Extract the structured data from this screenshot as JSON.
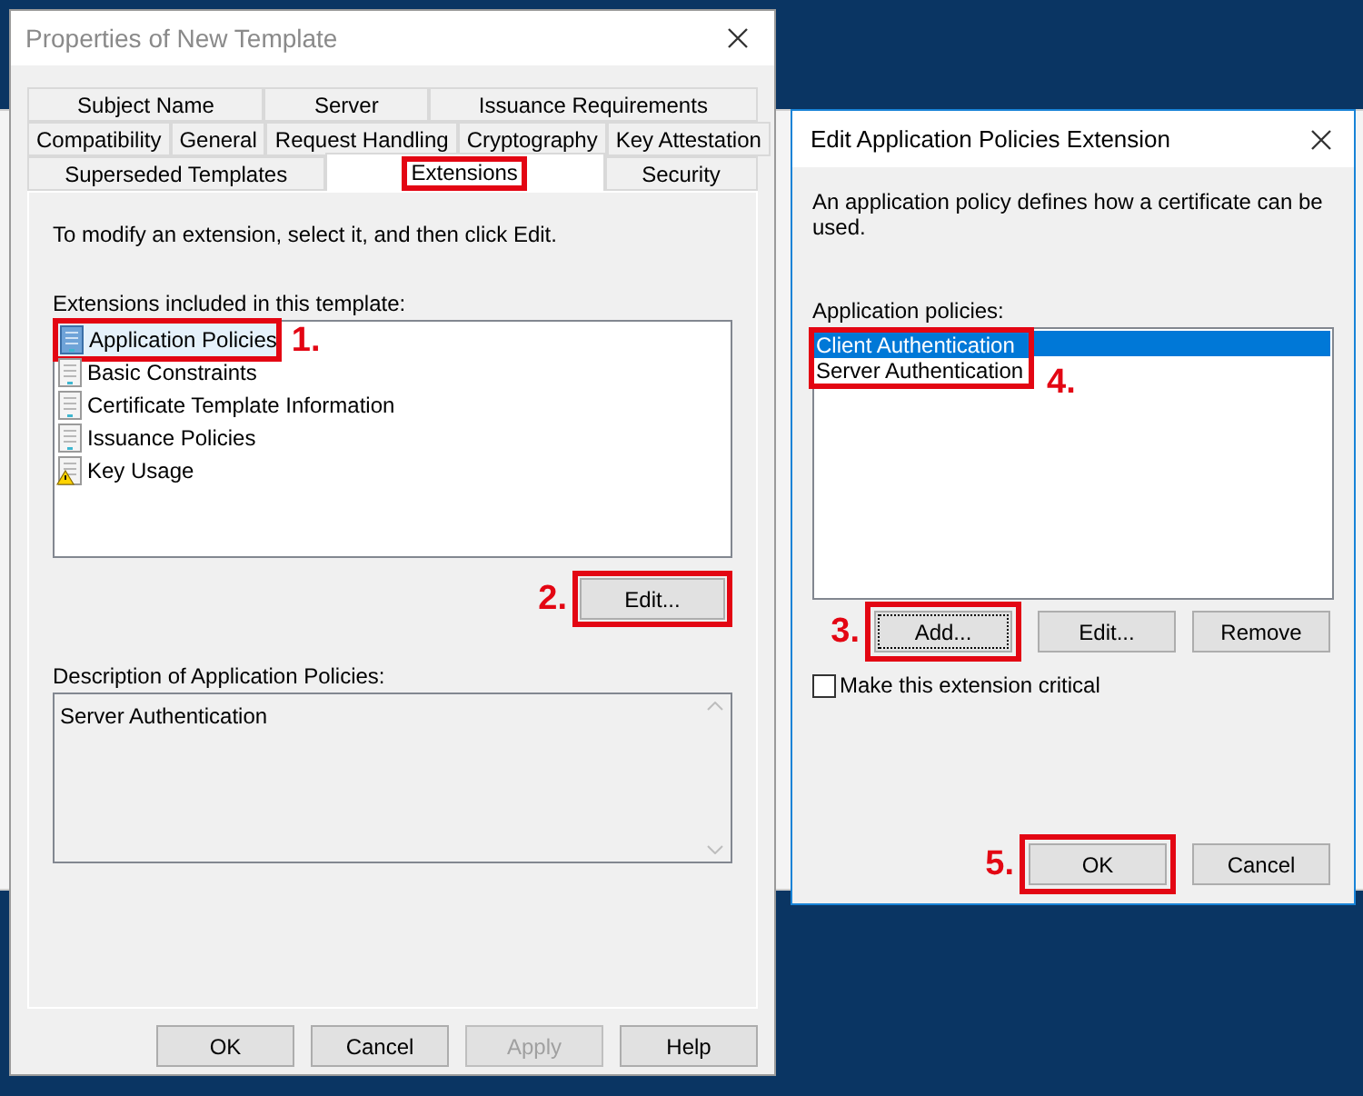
{
  "main_dialog": {
    "title": "Properties of New Template",
    "tab_rows": [
      [
        {
          "label": "Subject Name",
          "selected": false,
          "highlighted": false
        },
        {
          "label": "Server",
          "selected": false,
          "highlighted": false
        },
        {
          "label": "Issuance Requirements",
          "selected": false,
          "highlighted": false
        }
      ],
      [
        {
          "label": "Compatibility",
          "selected": false,
          "highlighted": false
        },
        {
          "label": "General",
          "selected": false,
          "highlighted": false
        },
        {
          "label": "Request Handling",
          "selected": false,
          "highlighted": false
        },
        {
          "label": "Cryptography",
          "selected": false,
          "highlighted": false
        },
        {
          "label": "Key Attestation",
          "selected": false,
          "highlighted": false
        }
      ],
      [
        {
          "label": "Superseded Templates",
          "selected": false,
          "highlighted": false
        },
        {
          "label": "Extensions",
          "selected": true,
          "highlighted": true
        },
        {
          "label": "Security",
          "selected": false,
          "highlighted": false
        }
      ]
    ],
    "instruction": "To modify an extension, select it, and then click Edit.",
    "extensions_label": "Extensions included in this template:",
    "extensions": [
      {
        "label": "Application Policies",
        "kind": "document",
        "selected": true,
        "step": "1."
      },
      {
        "label": "Basic Constraints",
        "kind": "document",
        "selected": false
      },
      {
        "label": "Certificate Template Information",
        "kind": "document",
        "selected": false
      },
      {
        "label": "Issuance Policies",
        "kind": "document",
        "selected": false
      },
      {
        "label": "Key Usage",
        "kind": "warning",
        "selected": false
      }
    ],
    "edit_button": {
      "label": "Edit...",
      "step": "2."
    },
    "description_label": "Description of Application Policies:",
    "description": "Server Authentication",
    "buttons": [
      {
        "label": "OK",
        "disabled": false
      },
      {
        "label": "Cancel",
        "disabled": false
      },
      {
        "label": "Apply",
        "disabled": true
      },
      {
        "label": "Help",
        "disabled": false
      }
    ]
  },
  "edit_dialog": {
    "title": "Edit Application Policies Extension",
    "description": "An application policy defines how a certificate can be used.",
    "policies_label": "Application policies:",
    "policies": [
      {
        "label": "Client Authentication",
        "selected": true
      },
      {
        "label": "Server Authentication",
        "selected": false
      }
    ],
    "policies_step": "4.",
    "list_buttons": [
      {
        "label": "Add...",
        "focused": true,
        "step": "3."
      },
      {
        "label": "Edit...",
        "focused": false
      },
      {
        "label": "Remove",
        "focused": false
      }
    ],
    "critical": {
      "label": "Make this extension critical",
      "checked": false
    },
    "buttons": [
      {
        "label": "OK",
        "step": "5."
      },
      {
        "label": "Cancel"
      }
    ]
  }
}
